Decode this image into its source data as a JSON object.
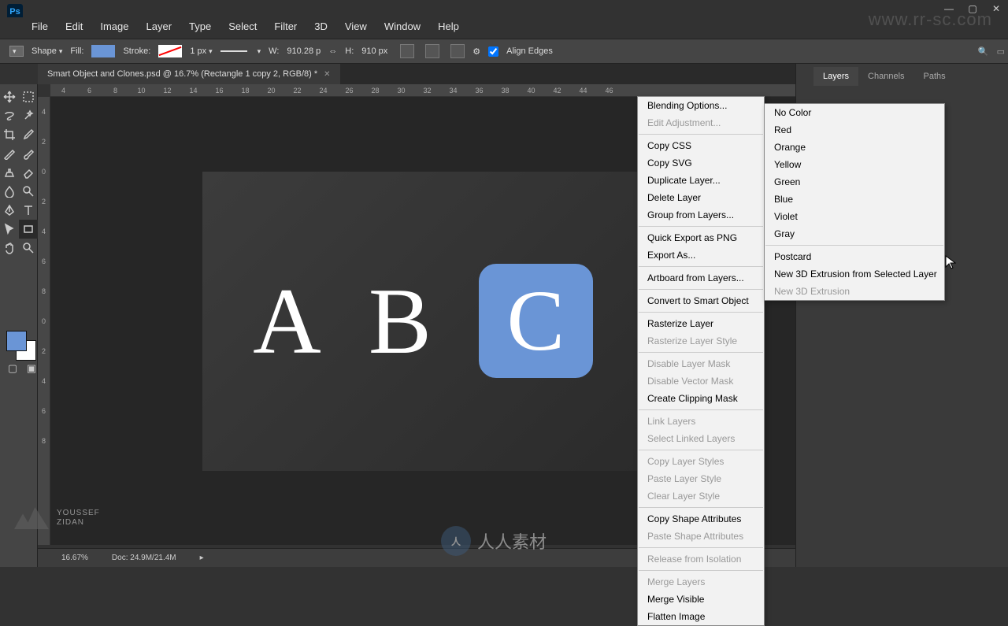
{
  "app": {
    "logo": "Ps"
  },
  "menu": {
    "file": "File",
    "edit": "Edit",
    "image": "Image",
    "layer": "Layer",
    "type": "Type",
    "select": "Select",
    "filter": "Filter",
    "threed": "3D",
    "view": "View",
    "window": "Window",
    "help": "Help"
  },
  "optbar": {
    "shape": "Shape",
    "fill": "Fill:",
    "stroke": "Stroke:",
    "stroke_val": "1 px",
    "w_label": "W:",
    "w_val": "910.28 p",
    "h_label": "H:",
    "h_val": "910 px",
    "align": "Align Edges"
  },
  "document": {
    "tab_title": "Smart Object and Clones.psd @ 16.7% (Rectangle 1 copy 2, RGB/8) *",
    "zoom": "16.67%",
    "doc_info": "Doc: 24.9M/21.4M"
  },
  "ruler_h": [
    "4",
    "6",
    "8",
    "10",
    "12",
    "14",
    "16",
    "18",
    "20",
    "22",
    "24",
    "26",
    "28",
    "30",
    "32",
    "34",
    "36",
    "38",
    "40",
    "42",
    "44",
    "46"
  ],
  "ruler_v": [
    "4",
    "2",
    "0",
    "2",
    "4",
    "6",
    "8",
    "0",
    "2",
    "4",
    "6",
    "8"
  ],
  "canvas": {
    "a": "A",
    "b": "B",
    "c": "C"
  },
  "panels": {
    "layers": "Layers",
    "channels": "Channels",
    "paths": "Paths"
  },
  "context": {
    "blending": "Blending Options...",
    "edit_adj": "Edit Adjustment...",
    "copy_css": "Copy CSS",
    "copy_svg": "Copy SVG",
    "dup": "Duplicate Layer...",
    "del": "Delete Layer",
    "group": "Group from Layers...",
    "quick_export": "Quick Export as PNG",
    "export_as": "Export As...",
    "artboard": "Artboard from Layers...",
    "convert_smart": "Convert to Smart Object",
    "rasterize": "Rasterize Layer",
    "rasterize_style": "Rasterize Layer Style",
    "disable_mask": "Disable Layer Mask",
    "disable_vmask": "Disable Vector Mask",
    "clipping": "Create Clipping Mask",
    "link": "Link Layers",
    "select_linked": "Select Linked Layers",
    "copy_style": "Copy Layer Styles",
    "paste_style": "Paste Layer Style",
    "clear_style": "Clear Layer Style",
    "copy_shape": "Copy Shape Attributes",
    "paste_shape": "Paste Shape Attributes",
    "release": "Release from Isolation",
    "merge_layers": "Merge Layers",
    "merge_visible": "Merge Visible",
    "flatten": "Flatten Image"
  },
  "submenu": {
    "no_color": "No Color",
    "red": "Red",
    "orange": "Orange",
    "yellow": "Yellow",
    "green": "Green",
    "blue": "Blue",
    "violet": "Violet",
    "gray": "Gray",
    "postcard": "Postcard",
    "ext_sel": "New 3D Extrusion from Selected Layer",
    "ext": "New 3D Extrusion"
  },
  "author": {
    "name": "YOUSSEF",
    "last": "ZIDAN"
  },
  "watermark": {
    "url": "www.rr-sc.com",
    "text": "人人素材"
  }
}
